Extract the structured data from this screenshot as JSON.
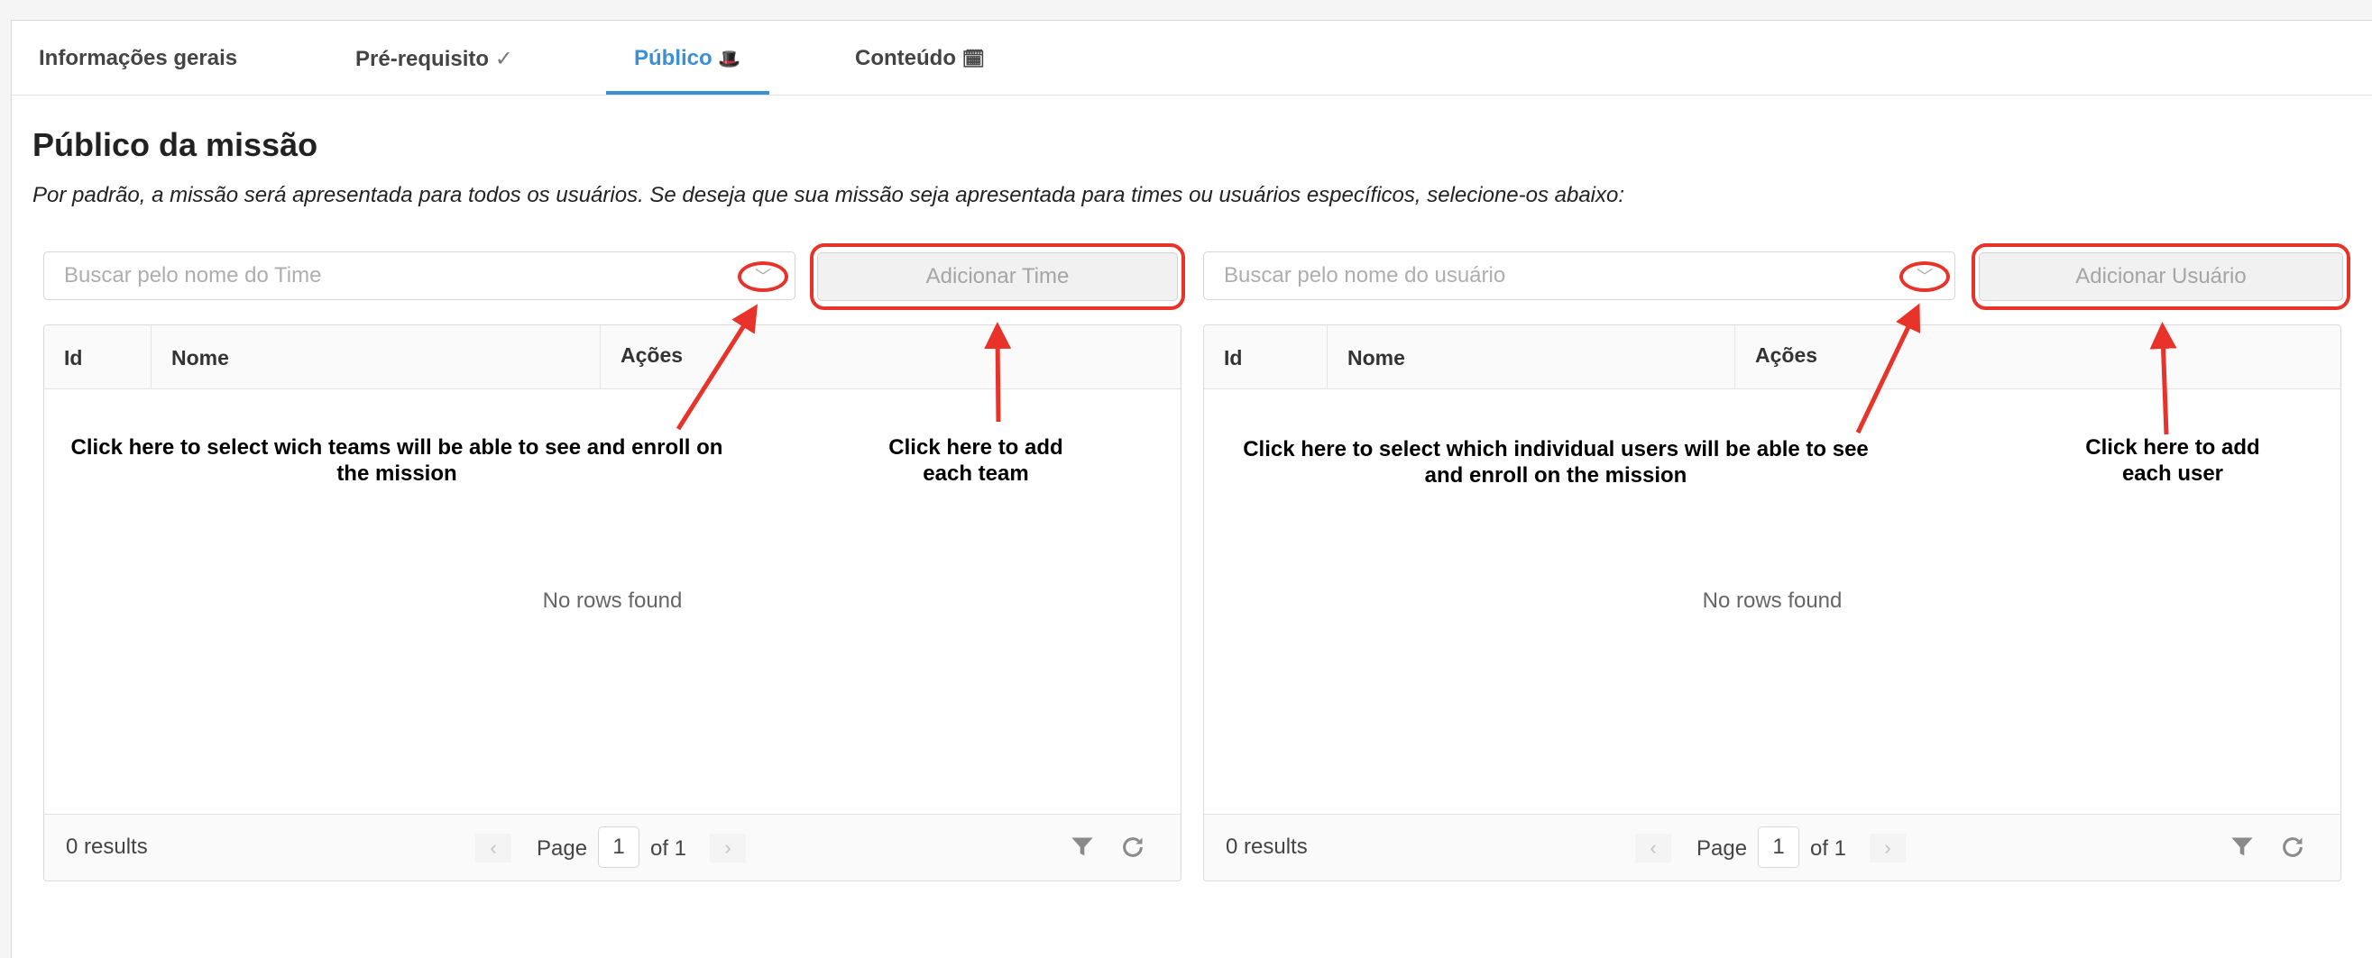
{
  "tabs": [
    {
      "label": "Informações gerais",
      "icon": ""
    },
    {
      "label": "Pré-requisito",
      "icon": "✓"
    },
    {
      "label": "Público",
      "icon": "🎩"
    },
    {
      "label": "Conteúdo",
      "icon": "🗓"
    }
  ],
  "active_tab": "Público",
  "accent_color": "#3a8fd6",
  "annotation_color": "#e8332a",
  "section": {
    "title": "Público da missão",
    "description": "Por padrão, a missão será apresentada para todos os usuários. Se deseja que sua missão seja apresentada para times ou usuários específicos, selecione-os abaixo:"
  },
  "teams": {
    "search_placeholder": "Buscar pelo nome do Time",
    "add_button": "Adicionar Time",
    "columns": [
      "Id",
      "Nome",
      "Ações"
    ],
    "empty_text": "No rows found",
    "results": "0 results",
    "page_label": "Page",
    "page_value": "1",
    "page_of": "of 1"
  },
  "users": {
    "search_placeholder": "Buscar pelo nome do usuário",
    "add_button": "Adicionar Usuário",
    "columns": [
      "Id",
      "Nome",
      "Ações"
    ],
    "empty_text": "No rows found",
    "results": "0 results",
    "page_label": "Page",
    "page_value": "1",
    "page_of": "of 1"
  },
  "annotations": {
    "teams_select": "Click here to select wich teams will be able to see and enroll on\nthe mission",
    "teams_add": "Click here to add\neach team",
    "users_select": "Click here to select which individual users will be able to see\nand enroll on the mission",
    "users_add": "Click here to add\neach user"
  }
}
